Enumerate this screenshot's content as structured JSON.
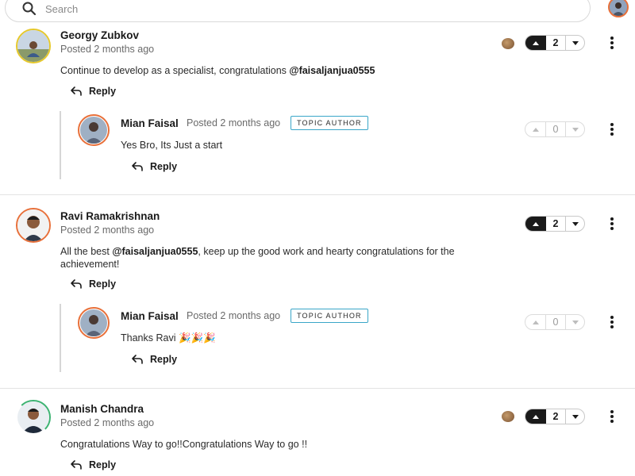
{
  "search": {
    "placeholder": "Search"
  },
  "comments": [
    {
      "author": "Georgy Zubkov",
      "posted": "Posted 2 months ago",
      "body_plain": "Continue to develop as a specialist, congratulations ",
      "body_mention": "@faisaljanjua0555",
      "body_after": "",
      "reply_label": "Reply",
      "votes": "2",
      "reply": {
        "author": "Mian Faisal",
        "posted": "Posted 2 months ago",
        "badge": "TOPIC AUTHOR",
        "body": "Yes Bro, Its Just a start",
        "reply_label": "Reply",
        "votes": "0"
      }
    },
    {
      "author": "Ravi Ramakrishnan",
      "posted": "Posted 2 months ago",
      "body_plain": "All the best ",
      "body_mention": "@faisaljanjua0555",
      "body_after": ", keep up the good work and hearty congratulations for the achievement!",
      "reply_label": "Reply",
      "votes": "2",
      "reply": {
        "author": "Mian Faisal",
        "posted": "Posted 2 months ago",
        "badge": "TOPIC AUTHOR",
        "body": "Thanks Ravi 🎉🎉🎉",
        "reply_label": "Reply",
        "votes": "0"
      }
    },
    {
      "author": "Manish Chandra",
      "posted": "Posted 2 months ago",
      "body_plain": "Congratulations Way to go!!Congratulations Way to go !!",
      "body_mention": "",
      "body_after": "",
      "reply_label": "Reply",
      "votes": "2"
    }
  ],
  "colors": {
    "accent_ring_orange": "#e8703a",
    "ring_yellow": "#e6c82a",
    "ring_green": "#3cb371",
    "badge_border": "#3aa6c8",
    "vote_active": "#1a1a1a"
  },
  "icons": {
    "search": "search-icon",
    "reply": "reply-arrow-icon",
    "more": "kebab-menu-icon",
    "upvote": "upvote-icon",
    "downvote": "downvote-icon",
    "medal": "medal-icon"
  }
}
